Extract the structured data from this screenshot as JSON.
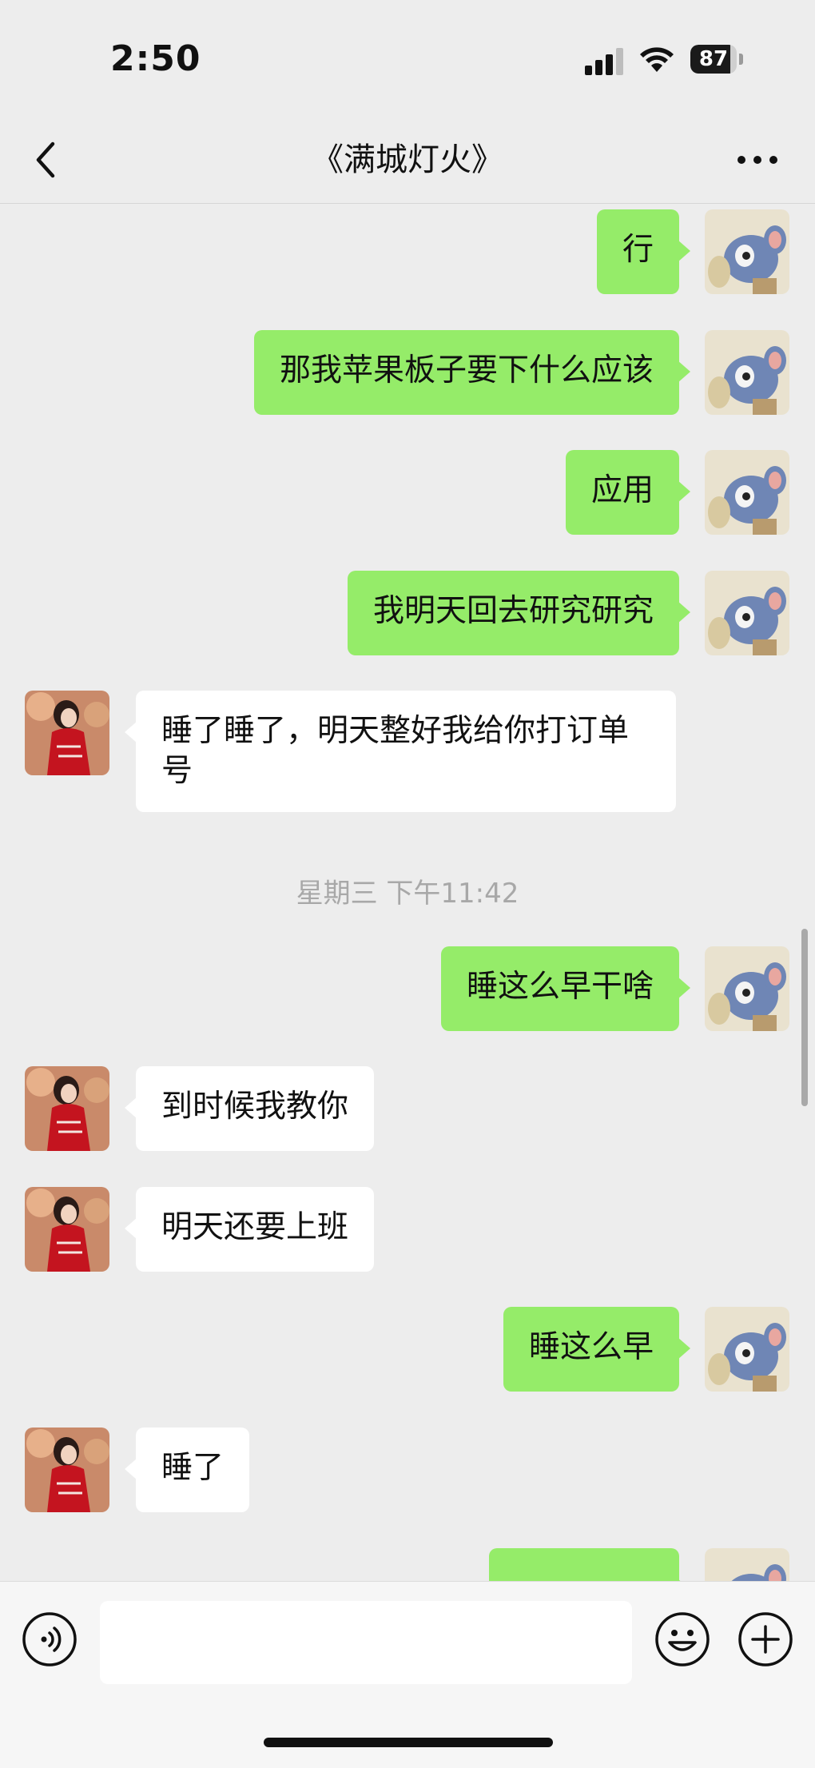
{
  "status_bar": {
    "time": "2:50",
    "battery": "87",
    "battery_level": 0.87
  },
  "header": {
    "title": "《满城灯火》"
  },
  "timestamp": "星期三 下午11:42",
  "messages": [
    {
      "side": "out",
      "text": "行"
    },
    {
      "side": "out",
      "text": "那我苹果板子要下什么应该"
    },
    {
      "side": "out",
      "text": "应用"
    },
    {
      "side": "out",
      "text": "我明天回去研究研究"
    },
    {
      "side": "in",
      "text": "睡了睡了，明天整好我给你打订单号"
    },
    {
      "side": "out",
      "text": "睡这么早干啥"
    },
    {
      "side": "in",
      "text": "到时候我教你"
    },
    {
      "side": "in",
      "text": "明天还要上班"
    },
    {
      "side": "out",
      "text": "睡这么早"
    },
    {
      "side": "in",
      "text": "睡了"
    },
    {
      "side": "out",
      "text": ""
    }
  ],
  "input": {
    "value": ""
  },
  "icons": {
    "back": "chevron-left-icon",
    "more": "more-dots-icon",
    "voice": "voice-icon",
    "emoji": "emoji-icon",
    "plus": "plus-icon",
    "signal": "cellular-signal-icon",
    "wifi": "wifi-icon",
    "battery": "battery-icon"
  },
  "colors": {
    "outgoing_bubble": "#95ec69",
    "incoming_bubble": "#ffffff",
    "background": "#ededed"
  }
}
